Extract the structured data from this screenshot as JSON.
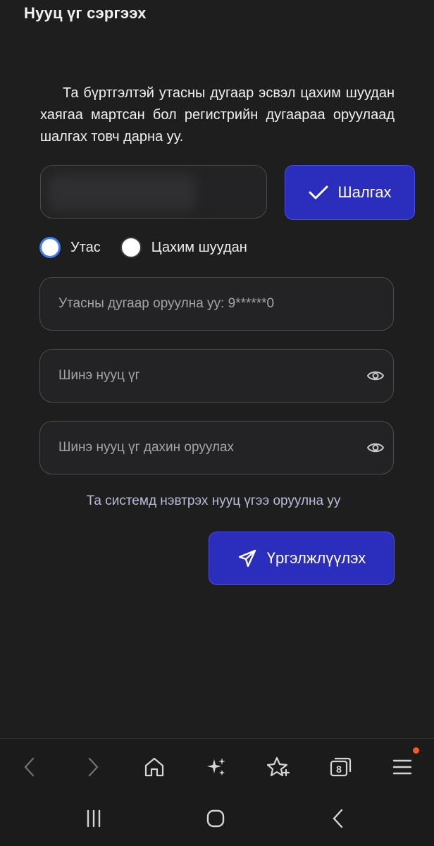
{
  "header": {
    "title": "Нууц үг сэргээх"
  },
  "instructions": "Та бүртгэлтэй утасны дугаар эсвэл цахим шуудан хаягаа мартсан бол регистрийн дугаараа оруулаад шалгах товч дарна уу.",
  "check_button": {
    "label": "Шалгах",
    "icon": "check-icon"
  },
  "contact_type": {
    "options": [
      {
        "label": "Утас",
        "selected": true
      },
      {
        "label": "Цахим шуудан",
        "selected": false
      }
    ]
  },
  "phone_field": {
    "placeholder": "Утасны дугаар оруулна уу: 9******0",
    "value": ""
  },
  "new_password_field": {
    "placeholder": "Шинэ нууц үг",
    "value": ""
  },
  "confirm_password_field": {
    "placeholder": "Шинэ нууц үг дахин оруулах",
    "value": ""
  },
  "hint": "Та системд нэвтрэх нууц үгээ оруулна уу",
  "continue_button": {
    "label": "Үргэлжлүүлэх",
    "icon": "send-icon"
  },
  "browser_toolbar": {
    "tab_count": "8",
    "icons": [
      "back-icon",
      "forward-icon",
      "home-icon",
      "sparkle-icon",
      "bookmark-star-icon",
      "tabs-icon",
      "menu-icon"
    ]
  },
  "colors": {
    "background": "#1e1e1f",
    "accent": "#2b2dbd",
    "radio_selected": "#3f7df0",
    "notification": "#f25b2a"
  }
}
